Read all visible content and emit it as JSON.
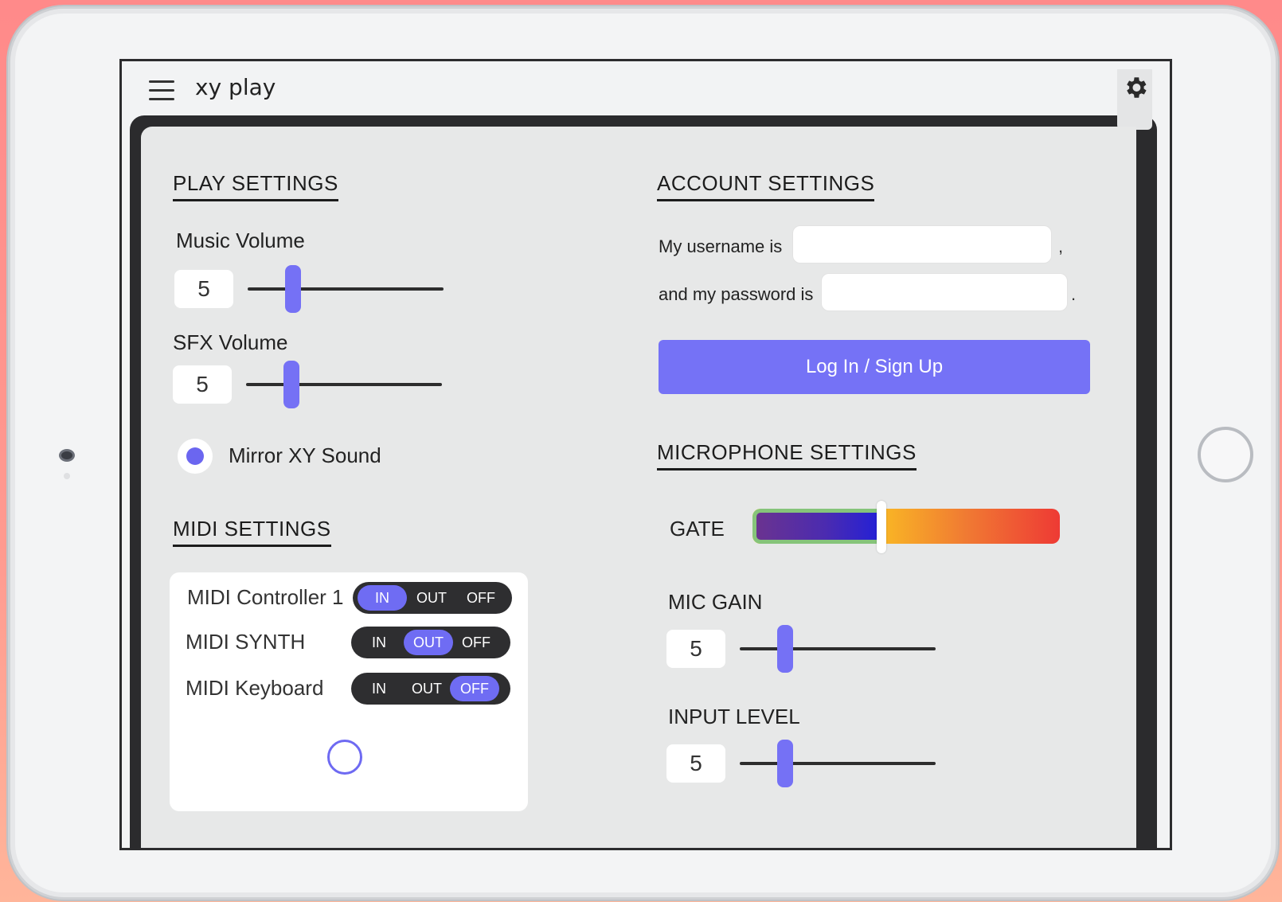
{
  "app": {
    "title": "xy play"
  },
  "play_settings": {
    "title": "PLAY SETTINGS",
    "music_volume": {
      "label": "Music Volume",
      "value": "5",
      "level": 0.23
    },
    "sfx_volume": {
      "label": "SFX Volume",
      "value": "5",
      "level": 0.23
    },
    "mirror": {
      "label": "Mirror XY Sound",
      "checked": true
    }
  },
  "midi_settings": {
    "title": "MIDI SETTINGS",
    "options": [
      "IN",
      "OUT",
      "OFF"
    ],
    "devices": [
      {
        "label": "MIDI Controller 1",
        "selected": "IN"
      },
      {
        "label": "MIDI SYNTH",
        "selected": "OUT"
      },
      {
        "label": "MIDI Keyboard",
        "selected": "OFF"
      }
    ]
  },
  "account_settings": {
    "title": "ACCOUNT SETTINGS",
    "username_prefix": "My username is",
    "username_suffix": ",",
    "username_value": "",
    "password_prefix": "and my password is",
    "password_suffix": ".",
    "password_value": "",
    "login_label": "Log In / Sign Up"
  },
  "microphone_settings": {
    "title": "MICROPHONE SETTINGS",
    "gate": {
      "label": "GATE",
      "level": 0.42
    },
    "mic_gain": {
      "label": "MIC GAIN",
      "value": "5",
      "level": 0.23
    },
    "input_level": {
      "label": "INPUT LEVEL",
      "value": "5",
      "level": 0.23
    }
  },
  "colors": {
    "accent": "#7572f6",
    "panel_dark": "#2b2b2d",
    "panel_light": "#e7e8e8"
  }
}
